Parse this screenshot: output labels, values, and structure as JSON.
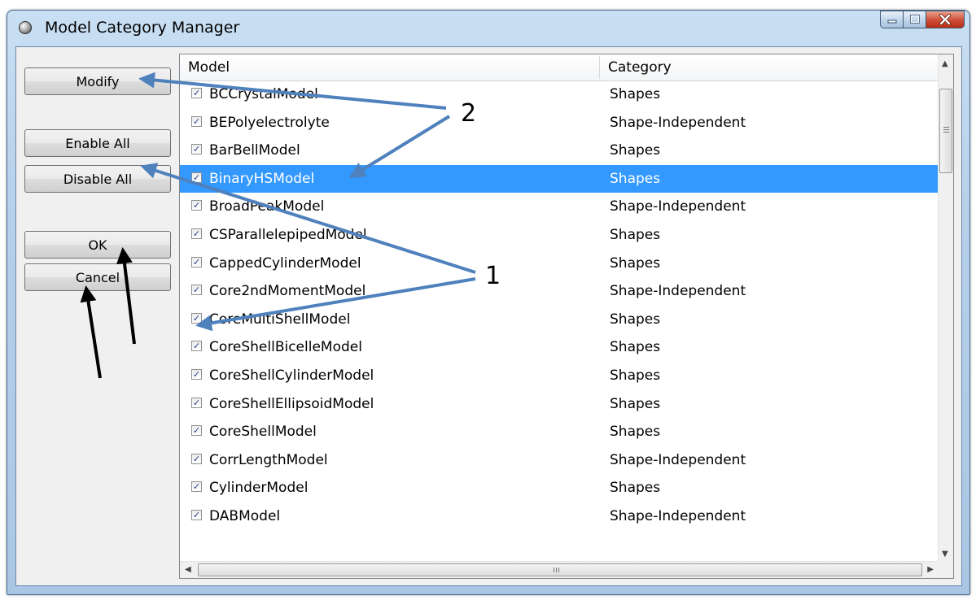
{
  "window": {
    "title": "Model Category Manager",
    "buttons": {
      "minimize": "minimize-icon",
      "maximize": "maximize-icon",
      "close": "close-icon"
    }
  },
  "side_buttons": {
    "modify": "Modify",
    "enable_all": "Enable All",
    "disable_all": "Disable All",
    "ok": "OK",
    "cancel": "Cancel"
  },
  "table": {
    "columns": [
      "Model",
      "Category"
    ],
    "rows": [
      {
        "model": "BCCrystalModel",
        "category": "Shapes",
        "checked": true,
        "selected": false
      },
      {
        "model": "BEPolyelectrolyte",
        "category": "Shape-Independent",
        "checked": true,
        "selected": false
      },
      {
        "model": "BarBellModel",
        "category": "Shapes",
        "checked": true,
        "selected": false
      },
      {
        "model": "BinaryHSModel",
        "category": "Shapes",
        "checked": true,
        "selected": true
      },
      {
        "model": "BroadPeakModel",
        "category": "Shape-Independent",
        "checked": true,
        "selected": false
      },
      {
        "model": "CSParallelepipedModel",
        "category": "Shapes",
        "checked": true,
        "selected": false
      },
      {
        "model": "CappedCylinderModel",
        "category": "Shapes",
        "checked": true,
        "selected": false
      },
      {
        "model": "Core2ndMomentModel",
        "category": "Shape-Independent",
        "checked": true,
        "selected": false
      },
      {
        "model": "CoreMultiShellModel",
        "category": "Shapes",
        "checked": true,
        "selected": false
      },
      {
        "model": "CoreShellBicelleModel",
        "category": "Shapes",
        "checked": true,
        "selected": false
      },
      {
        "model": "CoreShellCylinderModel",
        "category": "Shapes",
        "checked": true,
        "selected": false
      },
      {
        "model": "CoreShellEllipsoidModel",
        "category": "Shapes",
        "checked": true,
        "selected": false
      },
      {
        "model": "CoreShellModel",
        "category": "Shapes",
        "checked": true,
        "selected": false
      },
      {
        "model": "CorrLengthModel",
        "category": "Shape-Independent",
        "checked": true,
        "selected": false
      },
      {
        "model": "CylinderModel",
        "category": "Shapes",
        "checked": true,
        "selected": false
      },
      {
        "model": "DABModel",
        "category": "Shape-Independent",
        "checked": true,
        "selected": false
      }
    ]
  },
  "annotations": {
    "label_1": "1",
    "label_2": "2",
    "blue_arrow_color": "#4f81bd",
    "black_arrow_color": "#000000"
  },
  "colors": {
    "selection": "#3399ff",
    "title_gradient": "#b6d0ea"
  }
}
